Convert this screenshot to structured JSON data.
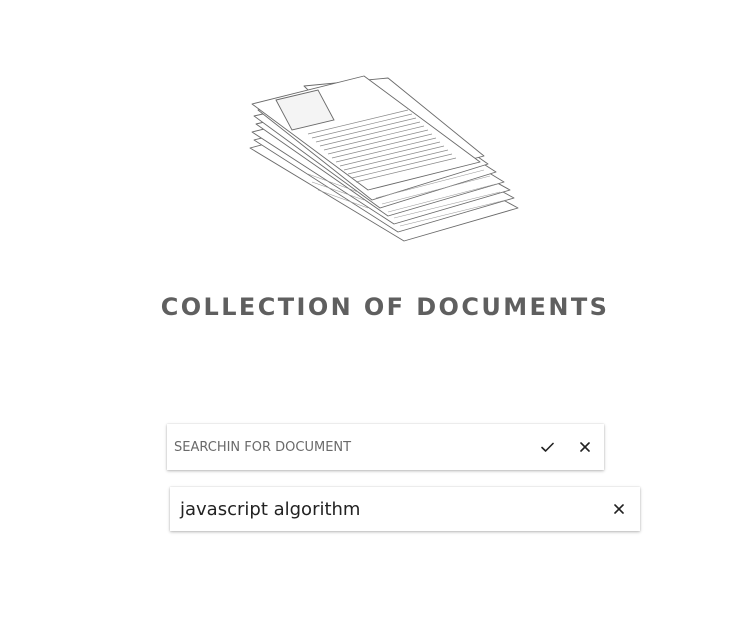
{
  "header": {
    "title": "COLLECTION OF DOCUMENTS",
    "illustration": "documents-stack-icon"
  },
  "search": {
    "placeholder": "SEARCHIN FOR DOCUMENT",
    "value": "",
    "confirm_icon": "checkmark-icon",
    "clear_icon": "close-icon"
  },
  "results": [
    {
      "label": "javascript algorithm",
      "remove_icon": "close-icon"
    }
  ],
  "colors": {
    "title": "#5f5f5f",
    "icon": "#222222",
    "background": "#ffffff"
  }
}
